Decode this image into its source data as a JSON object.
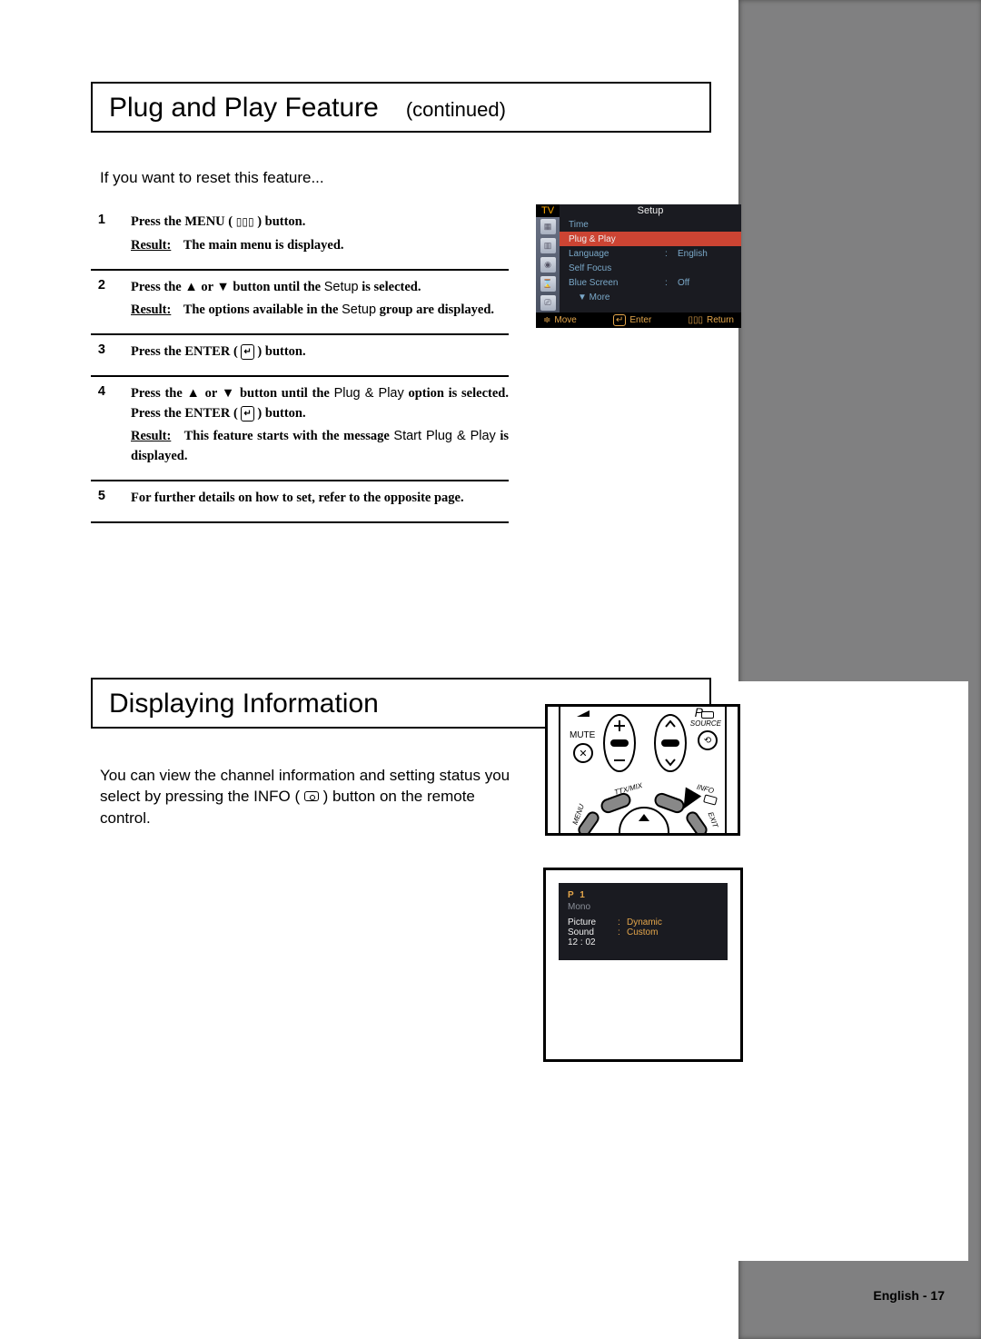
{
  "section1": {
    "title": "Plug and Play Feature",
    "subtitle": "(continued)",
    "intro": "If you want to reset this feature...",
    "steps": [
      {
        "num": "1",
        "line1a": "Press the ",
        "line1b": "MENU",
        "line1c": " ( ",
        "line1d": " ) button.",
        "result": "The main menu is displayed."
      },
      {
        "num": "2",
        "line1a": "Press the ",
        "line1b": "▲",
        "line1c": " or ",
        "line1d": "▼",
        "line1e": " button until the ",
        "line1f": "Setup",
        "line1g": " is selected.",
        "result_a": "The options available in the ",
        "result_b": "Setup",
        "result_c": " group are displayed."
      },
      {
        "num": "3",
        "line1a": "Press the ",
        "line1b": "ENTER",
        "line1c": " ( ",
        "line1d": " ) button."
      },
      {
        "num": "4",
        "line1a": "Press the ",
        "line1b": "▲",
        "line1c": " or ",
        "line1d": "▼",
        "line1e": " button until the ",
        "line1f": "Plug & Play",
        "line1g": " option is selected. Press the ",
        "line1h": "ENTER",
        "line1i": " ( ",
        "line1j": " ) button.",
        "result_a": "This feature starts with the message ",
        "result_b": "Start Plug & Play",
        "result_c": " is displayed."
      },
      {
        "num": "5",
        "line1": "For further details on how to set, refer to the opposite page."
      }
    ]
  },
  "osd": {
    "tv": "TV",
    "title": "Setup",
    "items": [
      {
        "k": "Time",
        "c": "",
        "v": ""
      },
      {
        "k": "Plug & Play",
        "c": "",
        "v": "",
        "selected": true
      },
      {
        "k": "Language",
        "c": ":",
        "v": "English"
      },
      {
        "k": "Self Focus",
        "c": "",
        "v": ""
      },
      {
        "k": "Blue Screen",
        "c": ":",
        "v": "Off"
      },
      {
        "k": "▼   More",
        "c": "",
        "v": "",
        "more": true
      }
    ],
    "foot": {
      "move": "Move",
      "enter": "Enter",
      "ret": "Return"
    }
  },
  "section2": {
    "title": "Displaying Information",
    "intro_a": "You can view the channel information and setting status you select by pressing the ",
    "intro_b": "INFO",
    "intro_c": " ( ",
    "intro_d": " ) button on the remote control."
  },
  "remote": {
    "mute": "MUTE",
    "p": "P",
    "source": "SOURCE",
    "ttx": "TTX/MIX",
    "info": "INFO",
    "menu": "MENU",
    "exit": "EXIT"
  },
  "info_osd": {
    "p1": "P   1",
    "mono": "Mono",
    "rows": [
      {
        "k": "Picture",
        "c": ":",
        "v": "Dynamic"
      },
      {
        "k": "Sound",
        "c": ":",
        "v": "Custom"
      },
      {
        "k": "12 : 02",
        "c": "",
        "v": ""
      }
    ]
  },
  "page_num": "English - 17"
}
